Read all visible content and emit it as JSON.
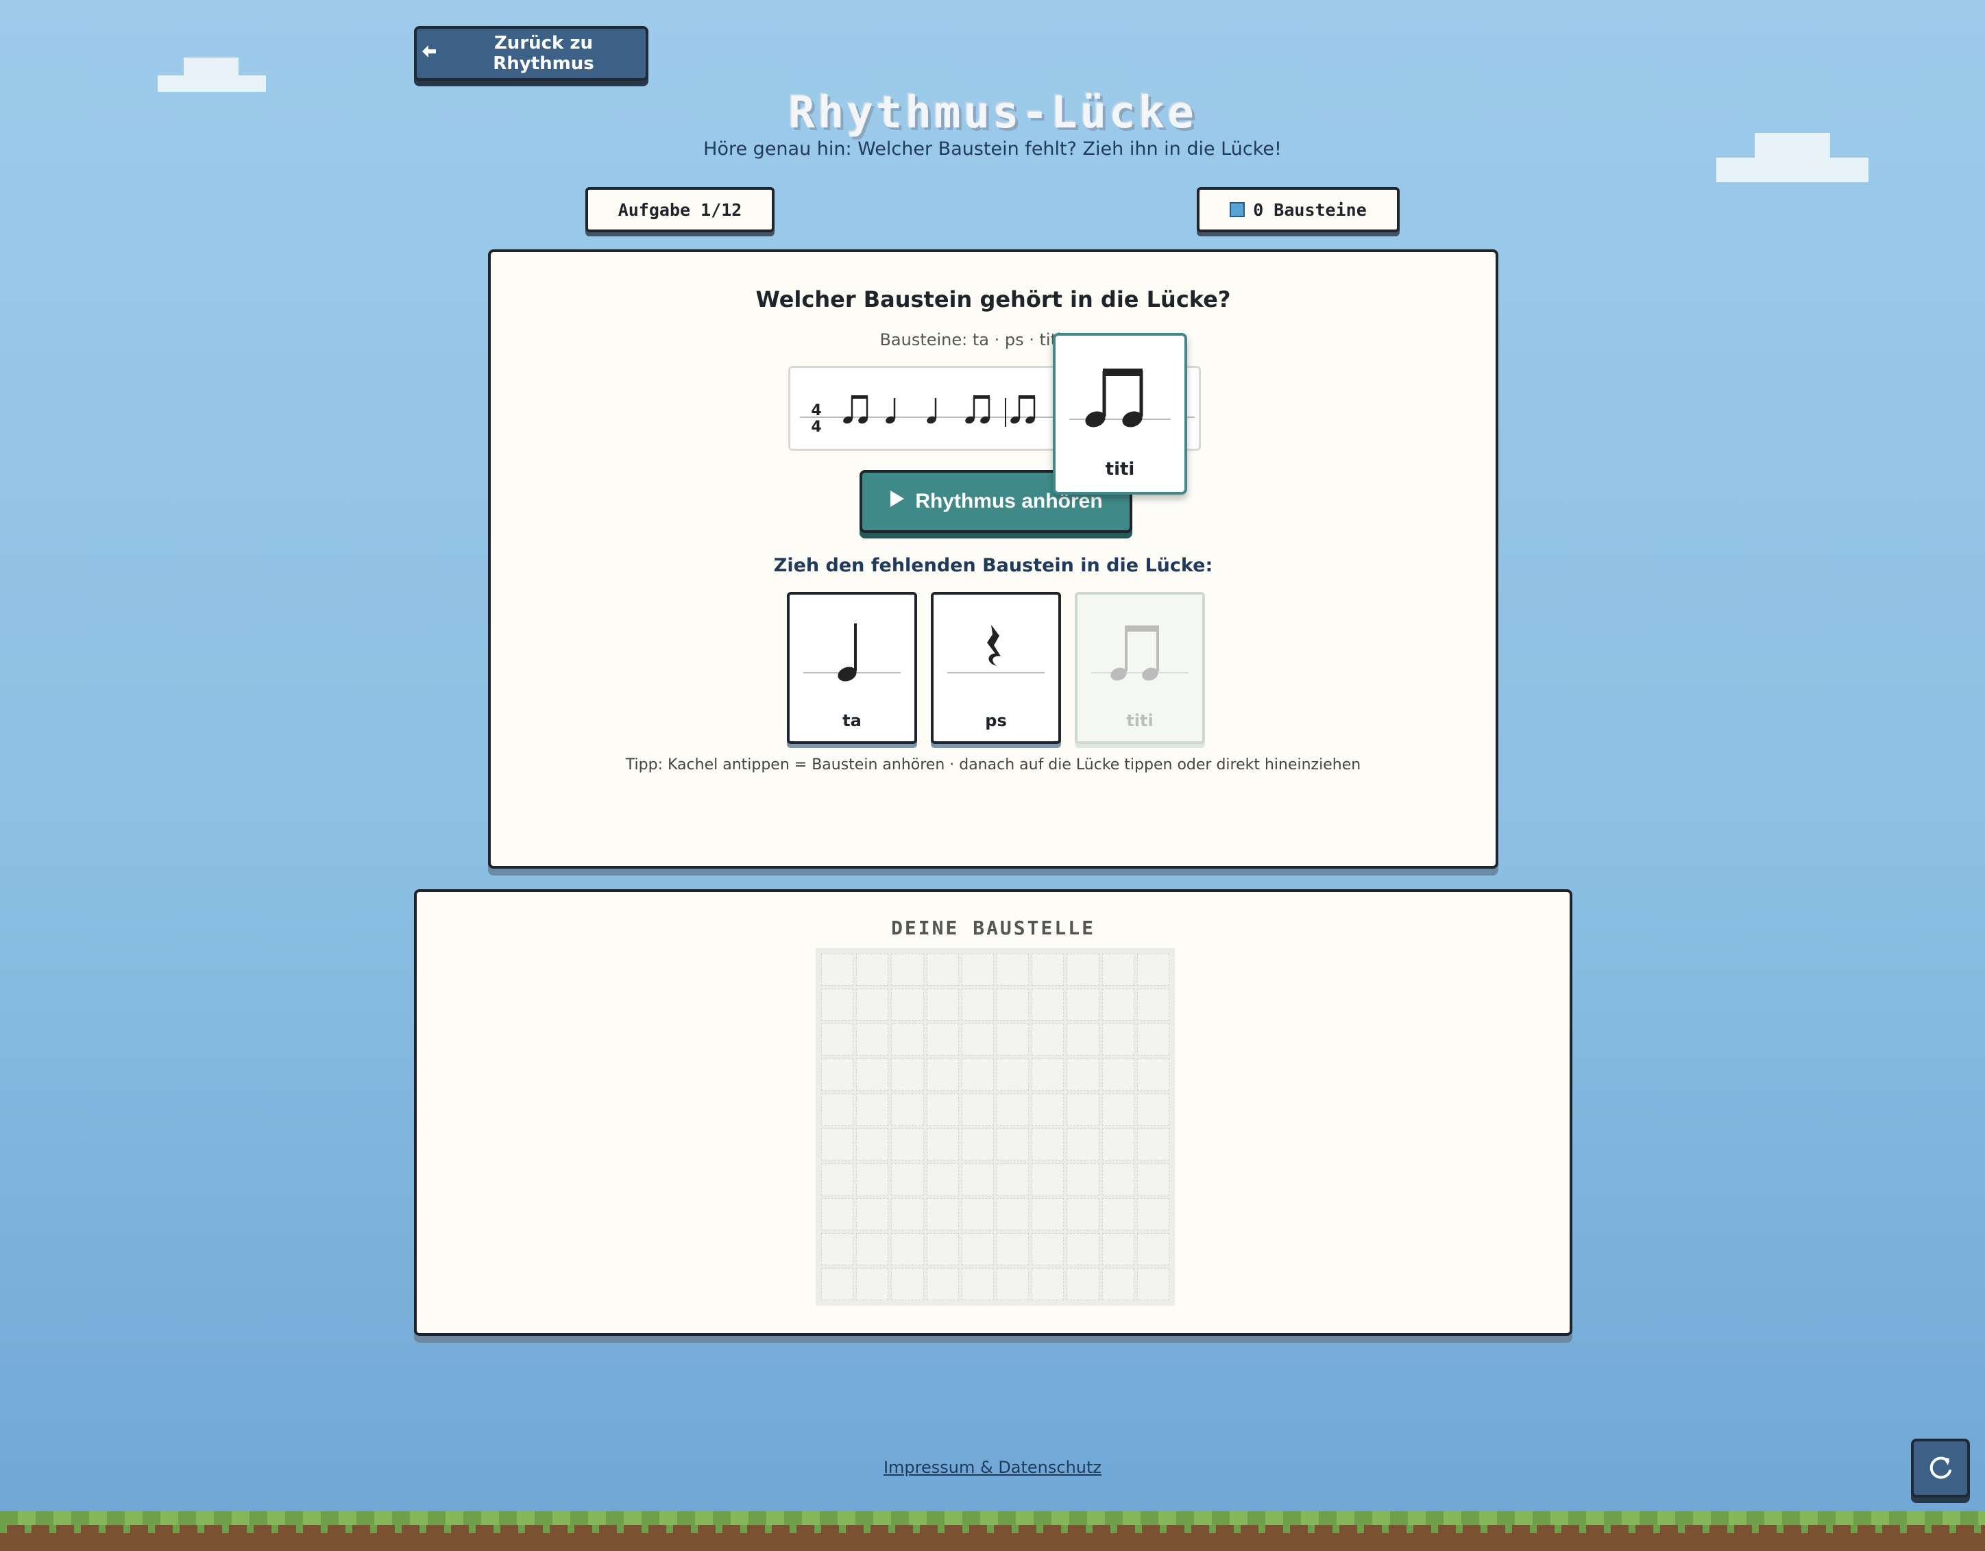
{
  "header": {
    "back_label": "Zurück zu Rhythmus",
    "title": "Rhythmus-Lücke",
    "subtitle": "Höre genau hin: Welcher Baustein fehlt? Zieh ihn in die Lücke!"
  },
  "status": {
    "task_label": "Aufgabe 1/12",
    "blocks_label": "0 Bausteine"
  },
  "exercise": {
    "question": "Welcher Baustein gehört in die Lücke?",
    "info_line": "Bausteine: ta · ps · titi – 4/4",
    "time_signature": {
      "top": "4",
      "bottom": "4"
    },
    "play_label": "Rhythmus anhören",
    "drag_prompt": "Zieh den fehlenden Baustein in die Lücke:",
    "dragging_tile_label": "titi",
    "tiles": [
      {
        "label": "ta",
        "state": "available"
      },
      {
        "label": "ps",
        "state": "available"
      },
      {
        "label": "titi",
        "state": "used"
      }
    ],
    "tip": "Tipp: Kachel antippen = Baustein anhören · danach auf die Lücke tippen oder direkt hineinziehen"
  },
  "build": {
    "title": "DEINE BAUSTELLE",
    "grid_cols": 10,
    "grid_rows": 10
  },
  "footer": {
    "link_label": "Impressum & Datenschutz"
  },
  "colors": {
    "sky": "#9ecbea",
    "primary_button": "#3d6186",
    "play_button": "#3f8a88",
    "panel": "#fdfcf7"
  }
}
